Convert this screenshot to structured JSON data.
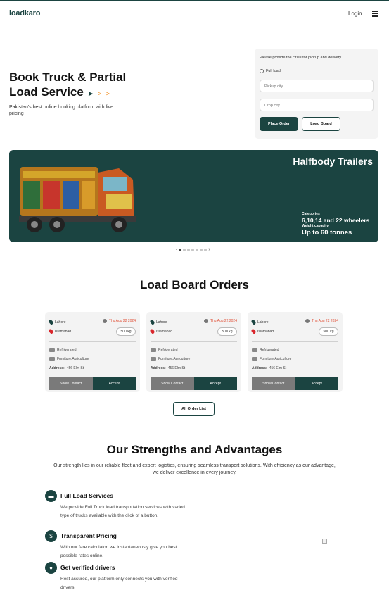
{
  "header": {
    "logo": "loadkaro",
    "login": "Login"
  },
  "hero": {
    "title": "Book Truck & Partial Load Service",
    "subtitle": "Pakistan's best online booking platform with live pricing"
  },
  "booking_form": {
    "prompt": "Please provide the cities for pickup and delivery.",
    "option": "Full load",
    "pickup_placeholder": "Pickup city",
    "drop_placeholder": "Drop city",
    "primary_button": "Place Order",
    "secondary_button": "Load Board"
  },
  "banner": {
    "title": "Halfbody Trailers",
    "categories_label": "Categories",
    "categories_value": "6,10,14 and 22 wheelers",
    "capacity_label": "Weight capacity",
    "capacity_value": "Up to 60 tonnes"
  },
  "carousel": {
    "prev": "‹",
    "next": "›",
    "count": 7,
    "active": 1
  },
  "load_board": {
    "title": "Load Board Orders",
    "orders": [
      {
        "from": "Lahore",
        "to": "Islamabad",
        "date": "Thu Aug 22 2024",
        "weight": "500 kg",
        "type": "Refrigerated",
        "goods": "Furniture,Agriculture",
        "address_label": "Address:",
        "address": "456 Elm St",
        "show": "Show Contact",
        "accept": "Accept"
      },
      {
        "from": "Lahore",
        "to": "Islamabad",
        "date": "Thu Aug 22 2024",
        "weight": "500 kg",
        "type": "Refrigerated",
        "goods": "Furniture,Agriculture",
        "address_label": "Address:",
        "address": "456 Elm St",
        "show": "Show Contact",
        "accept": "Accept"
      },
      {
        "from": "Lahore",
        "to": "Islamabad",
        "date": "Thu Aug 22 2024",
        "weight": "500 kg",
        "type": "Refrigerated",
        "goods": "Furniture,Agriculture",
        "address_label": "Address:",
        "address": "456 Elm St",
        "show": "Show Contact",
        "accept": "Accept"
      }
    ],
    "all_button": "All Order List"
  },
  "advantages": {
    "title": "Our Strengths and Advantages",
    "subtitle": "Our strength lies in our reliable fleet and expert logistics, ensuring seamless transport solutions. With efficiency as our advantage, we deliver excellence in every journey.",
    "features": [
      {
        "icon": "truck-icon",
        "title": "Full Load Services",
        "desc": "We provide Full Truck load transportation services with varied type of trucks available with the click of a button."
      },
      {
        "icon": "price-icon",
        "title": "Transparent Pricing",
        "desc": "With our fare calculator, we instantaneously give you best possible rates online."
      },
      {
        "icon": "driver-icon",
        "title": "Get verified drivers",
        "desc": "Rest assured, our platform only connects you with verified drivers."
      }
    ]
  },
  "colors": {
    "brand": "#1b4441",
    "accent_orange": "#f08c1c",
    "date_red": "#e0533b",
    "pin_red": "#d9262c"
  }
}
